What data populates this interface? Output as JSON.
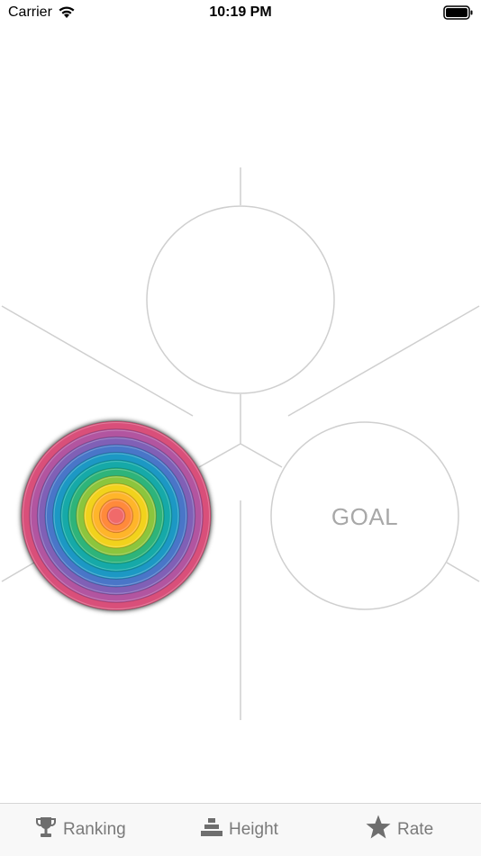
{
  "status_bar": {
    "carrier": "Carrier",
    "time": "10:19 PM"
  },
  "board": {
    "goal_label": "GOAL",
    "ring_colors": [
      "#d9507a",
      "#b255a0",
      "#8060b6",
      "#4876c8",
      "#1f98c4",
      "#12a9a8",
      "#2fb47a",
      "#8cc53e",
      "#f2d21e",
      "#ffb52b",
      "#ff8a3a",
      "#f06a6a"
    ]
  },
  "tab_bar": {
    "tabs": [
      {
        "label": "Ranking",
        "icon": "trophy-icon"
      },
      {
        "label": "Height",
        "icon": "stack-icon"
      },
      {
        "label": "Rate",
        "icon": "star-icon"
      }
    ]
  }
}
